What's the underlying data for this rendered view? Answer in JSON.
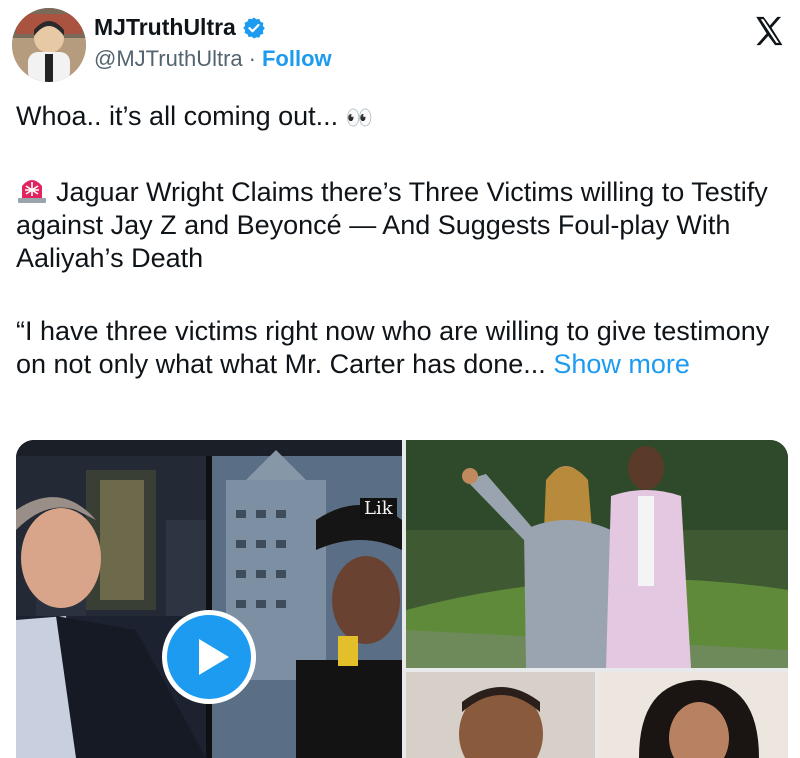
{
  "tweet": {
    "display_name": "MJTruthUltra",
    "handle": "@MJTruthUltra",
    "separator": "·",
    "follow_label": "Follow",
    "line1": "Whoa.. it’s all coming out...",
    "line1_emoji": "👀",
    "paragraph2": "Jaguar Wright Claims there’s Three Victims willing to Testify against Jay Z and Beyoncé — And Suggests Foul-play With Aaliyah’s Death",
    "paragraph3": "“I have three victims right now who are willing to give testimony on not only what what Mr. Carter has done...",
    "show_more": "Show more"
  },
  "media": {
    "video_caption_text": "Lik"
  },
  "colors": {
    "accent": "#1d9bf0",
    "text": "#0f1419",
    "secondary": "#536471",
    "siren": "#e0245e"
  },
  "icons": [
    "verified-badge-icon",
    "x-logo-icon",
    "siren-icon",
    "play-icon"
  ]
}
